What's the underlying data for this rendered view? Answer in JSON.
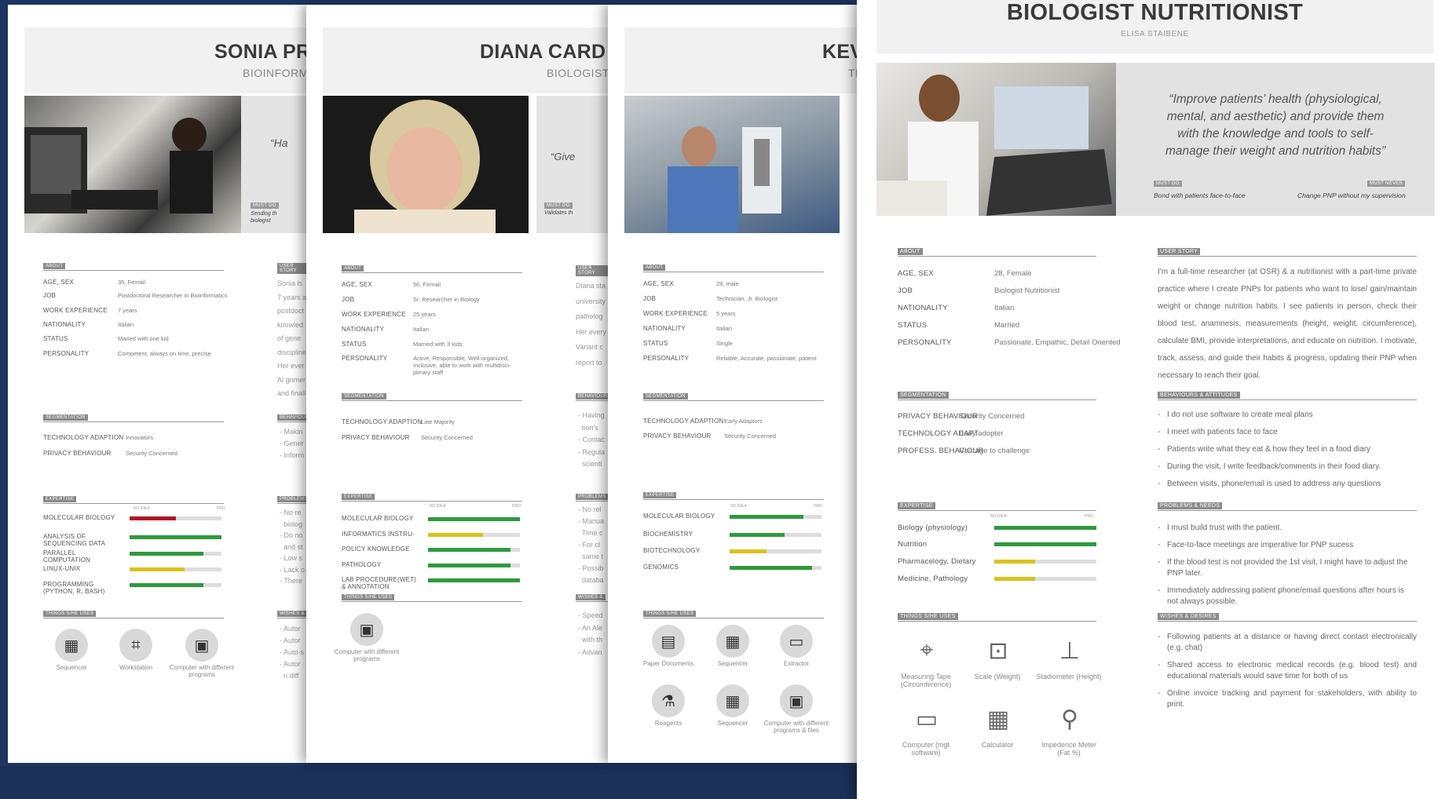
{
  "colors": {
    "background": "#1d3560",
    "green": "#2f9a3c",
    "yellow": "#d9c21b",
    "red": "#b3121f",
    "grey_bar": "#dddddd"
  },
  "cards": {
    "sonia": {
      "name": "SONIA PRE",
      "role": "BIOINFORMATIC",
      "quote": "“Ha",
      "must_do": "MUST DO",
      "must_do_text": "Sending th\nbiologist",
      "about_lbl": "ABOUT",
      "user_story_lbl": "USER STORY",
      "about": [
        {
          "k": "AGE, SEX",
          "v": "35, Femail"
        },
        {
          "k": "JOB",
          "v": "Postdoctoral Researcher in Bioinformatics"
        },
        {
          "k": "WORK EXPERIENCE",
          "v": "7 years"
        },
        {
          "k": "NATIONALITY",
          "v": "Italian"
        },
        {
          "k": "STATUS",
          "v": "Maried with one kid"
        },
        {
          "k": "PERSONALITY",
          "v": "Competent, always on time, precise"
        }
      ],
      "story_frag": [
        "Sonia is",
        "7 years a",
        "postdoct",
        "knowled",
        "of gene",
        "discipline",
        "Her ever",
        "Al gnmer",
        "and finall"
      ],
      "seg_lbl": "SEGMENTATION",
      "beh_lbl": "BEHAVIOURS",
      "segmentation": [
        {
          "k": "TECHNOLOGY ADAPTION",
          "v": "Innovators"
        },
        {
          "k": "PRIVACY BEHAVIOUR",
          "v": "Security Concerned"
        }
      ],
      "beh_frag": [
        "- Makin",
        "- Gener",
        "- Inform"
      ],
      "exp_lbl": "EXPERTISE",
      "prob_lbl": "PROBLEMS",
      "scale_lo": "NO IDEA",
      "scale_hi": "PRO",
      "expertise": [
        {
          "k": "MOLECULAR BIOLOGY",
          "level": 0.5,
          "color": "#b3121f"
        },
        {
          "k": "ANALYSIS OF SEQUENCING DATA",
          "level": 1.0,
          "color": "#2f9a3c"
        },
        {
          "k": "PARALLEL COMPUTATION",
          "level": 0.8,
          "color": "#2f9a3c"
        },
        {
          "k": "LINUX-UNIX",
          "level": 0.6,
          "color": "#d9c21b"
        },
        {
          "k": "PROGRAMMING (PYTHON, R, BASH)",
          "level": 0.8,
          "color": "#2f9a3c"
        }
      ],
      "prob_frag": [
        "- No re",
        "  biolog",
        "- Do no",
        "  and st",
        "- Low s",
        "- Lack o",
        "- There"
      ],
      "things_lbl": "THINGS S/HE USES",
      "wish_lbl": "WISHES &",
      "things": [
        {
          "icon": "sequencer-icon",
          "glyph": "▦",
          "label": "Sequencer"
        },
        {
          "icon": "workstation-icon",
          "glyph": "⌗",
          "label": "Workstation"
        },
        {
          "icon": "computer-icon",
          "glyph": "▣",
          "label": "Computer with different programs"
        }
      ],
      "wish_frag": [
        "- Autor",
        "- Autor",
        "- Auto-s",
        "- Autor",
        "  n diff"
      ]
    },
    "diana": {
      "name": "DIANA CARD",
      "role": "BIOLOGIST",
      "quote": "“Give",
      "must_do": "MUST DO",
      "must_do_text": "Validates th",
      "about_lbl": "ABOUT",
      "user_story_lbl": "USER STORY",
      "about": [
        {
          "k": "AGE, SEX",
          "v": "56, Femail"
        },
        {
          "k": "JOB",
          "v": "Sr. Researcher in Biology"
        },
        {
          "k": "WORK EXPERIENCE",
          "v": "25 years"
        },
        {
          "k": "NATIONALITY",
          "v": "Italian"
        },
        {
          "k": "STATUS",
          "v": "Married with 3 kids"
        },
        {
          "k": "PERSONALITY",
          "v": "Active, Responsible, Well-organized, Inclusive, able to work with multidisci-plinary staff"
        }
      ],
      "story_frag": [
        "Diana sta",
        "university",
        "patholog",
        "Her every",
        "Variant c",
        "report to"
      ],
      "seg_lbl": "SEGMENTATION",
      "beh_lbl": "BEHAVIOURS",
      "segmentation": [
        {
          "k": "TECHNOLOGY ADAPTION",
          "v": "Late Majority"
        },
        {
          "k": "PRIVACY BEHAVIOUR",
          "v": "Security Concerned"
        }
      ],
      "beh_frag": [
        "- Having",
        "  tion's",
        "- Contac",
        "- Regula",
        "  scienti"
      ],
      "exp_lbl": "EXPERTISE",
      "prob_lbl": "PROBLEMS",
      "scale_lo": "NO IDEA",
      "scale_hi": "PRO",
      "expertise": [
        {
          "k": "MOLECULAR BIOLOGY",
          "level": 1.0,
          "color": "#2f9a3c"
        },
        {
          "k": "INFORMATICS INSTRU-",
          "level": 0.6,
          "color": "#d9c21b"
        },
        {
          "k": "POLICY KNOWLEDGE",
          "level": 0.9,
          "color": "#2f9a3c"
        },
        {
          "k": "PATHOLOGY",
          "level": 0.9,
          "color": "#2f9a3c"
        },
        {
          "k": "LAB PROCEDURE(WET) & ANNOTATION",
          "level": 1.0,
          "color": "#2f9a3c"
        }
      ],
      "prob_frag": [
        "- No rel",
        "- Manua",
        "  Time c",
        "- For cl",
        "  same t",
        "- Possib",
        "  databa"
      ],
      "things_lbl": "THINGS S/HE USES",
      "wish_lbl": "WISHES &",
      "things": [
        {
          "icon": "computer-icon",
          "glyph": "▣",
          "label": "Computer with different programs"
        }
      ],
      "wish_frag": [
        "- Speed",
        "- An Ale",
        "  with th",
        "- Advan"
      ]
    },
    "kevin": {
      "name": "KEVIN",
      "role": "TE",
      "about_lbl": "ABOUT",
      "about": [
        {
          "k": "AGE, SEX",
          "v": "28, male"
        },
        {
          "k": "JOB",
          "v": "Technician, Jr. Biologist"
        },
        {
          "k": "WORK EXPERIENCE",
          "v": "5 years"
        },
        {
          "k": "NATIONALITY",
          "v": "Italian"
        },
        {
          "k": "STATUS",
          "v": "Single"
        },
        {
          "k": "PERSONALITY",
          "v": "Reliable, Accurate, passionate, patient"
        }
      ],
      "seg_lbl": "SEGMENTATION",
      "segmentation": [
        {
          "k": "TECHNOLOGY ADAPTION",
          "v": "Early Adaptors"
        },
        {
          "k": "PRIVACY BEHAVIOUR",
          "v": "Security Concerned"
        }
      ],
      "exp_lbl": "EXPERTISE",
      "scale_lo": "NO IDEA",
      "scale_hi": "PRO",
      "expertise": [
        {
          "k": "MOLECULAR BIOLOGY",
          "level": 0.8,
          "color": "#2f9a3c"
        },
        {
          "k": "BIOCHEMISTRY",
          "level": 0.6,
          "color": "#2f9a3c"
        },
        {
          "k": "BIOTECHNOLOGY",
          "level": 0.4,
          "color": "#d9c21b"
        },
        {
          "k": "GENOMICS",
          "level": 0.9,
          "color": "#2f9a3c"
        }
      ],
      "things_lbl": "THINGS S/HE USES",
      "things": [
        {
          "icon": "paper-documents-icon",
          "glyph": "▤",
          "label": "Paper Documents"
        },
        {
          "icon": "sequencer-icon",
          "glyph": "▦",
          "label": "Sequencer"
        },
        {
          "icon": "extractor-icon",
          "glyph": "▭",
          "label": "Extractor"
        },
        {
          "icon": "reagents-icon",
          "glyph": "⚗",
          "label": "Reagents"
        },
        {
          "icon": "sequencer-icon",
          "glyph": "▦",
          "label": "Sequencer"
        },
        {
          "icon": "computer-icon",
          "glyph": "▣",
          "label": "Computer with different programs & files"
        }
      ]
    },
    "elisa": {
      "name": "BIOLOGIST NUTRITIONIST",
      "role": "ELISA STAIBENE",
      "quote": "“Improve patients’ health (physiological, mental, and aesthetic) and provide them with the knowledge and tools to self-manage their weight and nutrition habits”",
      "must_do": "MUST DO",
      "must_do_text": "Bond with patients face-to-face",
      "must_never": "MUST NEVER",
      "must_never_text": "Change PNP without my supervision",
      "about_lbl": "ABOUT",
      "user_story_lbl": "USER STORY",
      "about": [
        {
          "k": "AGE, SEX",
          "v": "28, Female"
        },
        {
          "k": "JOB",
          "v": "Biologist Nutritionist"
        },
        {
          "k": "NATIONALITY",
          "v": "Italian"
        },
        {
          "k": "STATUS",
          "v": "Married"
        },
        {
          "k": "PERSONALITY",
          "v": "Passionate, Empathic, Detail Oriented"
        }
      ],
      "user_story": "I'm a full-time researcher (at OSR) & a nutritionist with a part-time private practice where I create PNPs for patients who want to lose/ gain/maintain weight or change nutrition habits. I see patients in person, check their blood test, anamnesis, measurements (height, weight, circumference), calculate BMI, provide interpretations, and educate on nutrition. I motivate, track, assess, and guide their habits & progress, updating their PNP when necessary to reach their goal.",
      "seg_lbl": "SEGMENTATION",
      "beh_lbl": "BEHAVIOURS & ATTITUDES",
      "segmentation": [
        {
          "k": "PRIVACY BEHAVIOUR",
          "v": "Security Concerned"
        },
        {
          "k": "TECHNOLOGY ADAPT.",
          "v": "Early adopter"
        },
        {
          "k": "PROFESS. BEHAVIOUR",
          "v": "Courage to challenge"
        }
      ],
      "behaviours": [
        "I do not use software to create meal plans",
        "I meet with patients face to face",
        "Patients write what they eat & how they feel in a food diary",
        "During the visit, I write feedback/comments in their food diary.",
        "Between visits, phone/email is used to address any questions"
      ],
      "exp_lbl": "EXPERTISE",
      "prob_lbl": "PROBLEMS & NEEDS",
      "scale_lo": "NO IDEA",
      "scale_hi": "PRO",
      "expertise": [
        {
          "k": "Biology (physiology)",
          "level": 1.0,
          "color": "#2f9a3c"
        },
        {
          "k": "Nutrition",
          "level": 1.0,
          "color": "#2f9a3c"
        },
        {
          "k": "Pharmacology, Dietary",
          "level": 0.4,
          "color": "#d9c21b"
        },
        {
          "k": "Medicine, Pathology",
          "level": 0.4,
          "color": "#d9c21b"
        }
      ],
      "problems": [
        "I must build trust with the patient.",
        "Face-to-face meetings are imperative for PNP sucess",
        "If the blood test is not provided the 1st visit, I might have to adjust the PNP later.",
        "Immediately addressing patient phone/email questions after hours is not always possible."
      ],
      "things_lbl": "THINGS S/HE USES",
      "wish_lbl": "WISHES & DESIRES",
      "things": [
        {
          "icon": "measuring-tape-icon",
          "glyph": "⌖",
          "label": "Measuring Tape (Circumference)"
        },
        {
          "icon": "scale-icon",
          "glyph": "⊡",
          "label": "Scale (Weight)"
        },
        {
          "icon": "stadiometer-icon",
          "glyph": "⊥",
          "label": "Stadiometer (Height)"
        },
        {
          "icon": "computer-icon",
          "glyph": "▭",
          "label": "Computer (mgt software)"
        },
        {
          "icon": "calculator-icon",
          "glyph": "▦",
          "label": "Calculator"
        },
        {
          "icon": "impedence-meter-icon",
          "glyph": "⚲",
          "label": "Impedence Meter (Fat %)"
        }
      ],
      "wishes": [
        "Following patients at a distance or having direct contact electronically (e.g. chat)",
        "Shared access to electronic medical records (e.g. blood test) and educational materials would save time for both of us",
        "Online invoice tracking and payment for stakeholders, with ability to print."
      ]
    }
  }
}
